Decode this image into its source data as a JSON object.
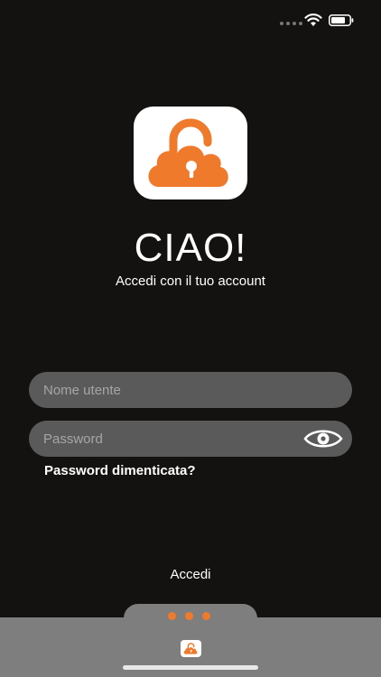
{
  "colors": {
    "background": "#141210",
    "accent": "#f07a2c",
    "field_bg": "#5a5a5a",
    "bottom_bar": "#7e7e7e"
  },
  "status_bar": {
    "icons": [
      "signal-dots-icon",
      "wifi-icon",
      "battery-icon"
    ]
  },
  "logo": {
    "icon": "cloud-lock-icon"
  },
  "greeting": "CIAO!",
  "subtitle": "Accedi con il tuo account",
  "form": {
    "username": {
      "placeholder": "Nome utente",
      "value": ""
    },
    "password": {
      "placeholder": "Password",
      "value": "",
      "toggle_icon": "eye-icon"
    },
    "forgot_password_label": "Password dimenticata?"
  },
  "login_label": "Accedi",
  "bottom_bar": {
    "page_dots": 3,
    "icon": "cloud-lock-icon"
  }
}
